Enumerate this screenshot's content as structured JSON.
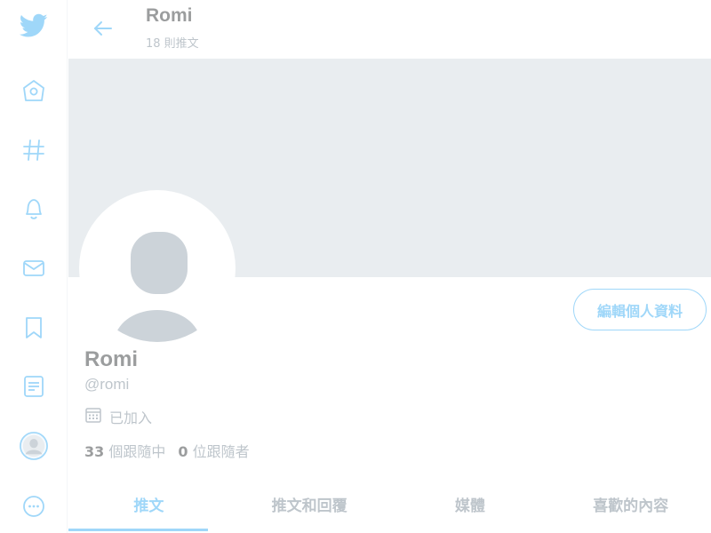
{
  "header": {
    "title": "Romi",
    "subtitle": "18 則推文"
  },
  "profile": {
    "name": "Romi",
    "handle": "@romi",
    "joined": "已加入",
    "edit_label": "編輯個人資料",
    "following_count": "33",
    "following_label": "個跟隨中",
    "followers_count": "0",
    "followers_label": "位跟隨者"
  },
  "tabs": [
    {
      "label": "推文",
      "active": true
    },
    {
      "label": "推文和回覆",
      "active": false
    },
    {
      "label": "媒體",
      "active": false
    },
    {
      "label": "喜歡的內容",
      "active": false
    }
  ],
  "nav": [
    {
      "icon": "twitter-bird-icon"
    },
    {
      "icon": "home-icon"
    },
    {
      "icon": "hashtag-icon"
    },
    {
      "icon": "bell-icon"
    },
    {
      "icon": "mail-icon"
    },
    {
      "icon": "bookmark-icon"
    },
    {
      "icon": "list-icon"
    },
    {
      "icon": "profile-avatar-icon"
    },
    {
      "icon": "more-icon"
    }
  ],
  "colors": {
    "accent": "#1da1f2",
    "banner": "#ccd6dd",
    "muted": "#657786"
  }
}
